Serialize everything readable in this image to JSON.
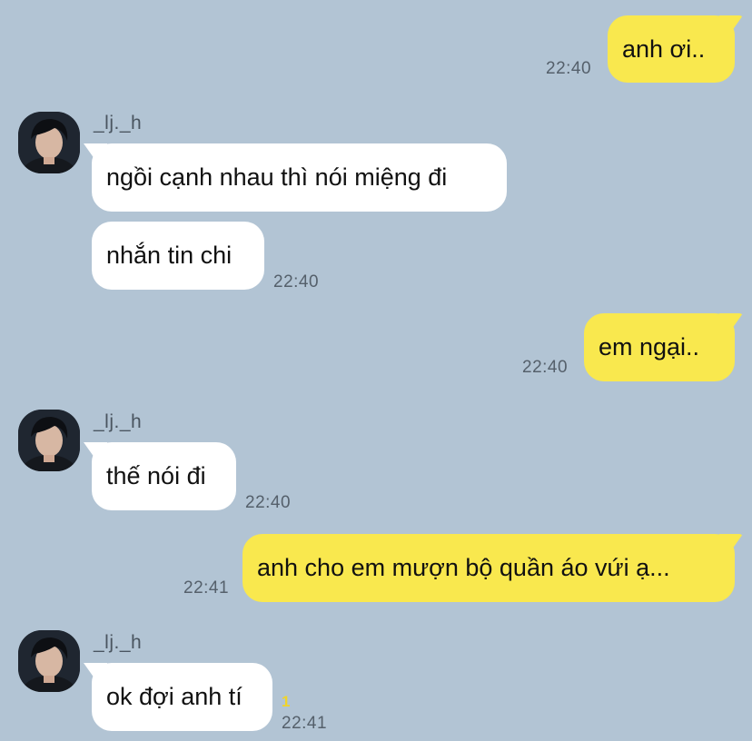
{
  "messages": [
    {
      "text": "anh ơi..",
      "time": "22:40"
    },
    {
      "sender": "_lj._h",
      "text": "ngồi cạnh nhau thì nói miệng đi"
    },
    {
      "text": "nhắn tin chi",
      "time": "22:40"
    },
    {
      "text": "em ngại..",
      "time": "22:40"
    },
    {
      "sender": "_lj._h",
      "text": "thế nói đi",
      "time": "22:40"
    },
    {
      "text": "anh cho em mượn bộ quần áo vứi ạ...",
      "time": "22:41"
    },
    {
      "sender": "_lj._h",
      "text": "ok đợi anh tí",
      "time": "22:41",
      "unread": "1"
    }
  ],
  "colors": {
    "background": "#b2c4d4",
    "outgoing_bubble": "#f9e84e",
    "incoming_bubble": "#ffffff"
  }
}
